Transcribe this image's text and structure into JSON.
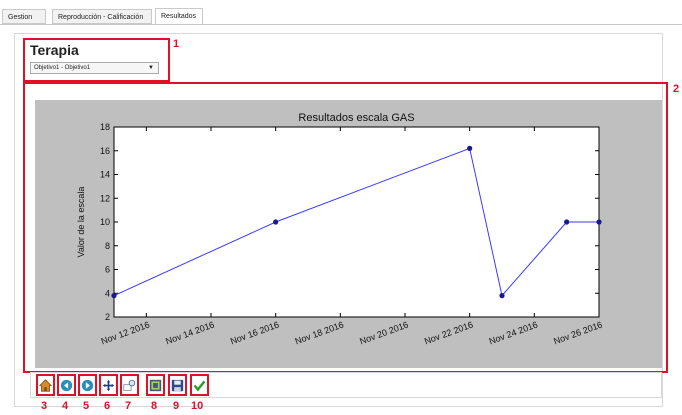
{
  "tabs": [
    {
      "label": "Gestion"
    },
    {
      "label": "Reproducción - Calificación"
    },
    {
      "label": "Resultados"
    }
  ],
  "section": {
    "title": "Terapia",
    "selected_objective": "Objetivo1 - Objetivo1"
  },
  "annotations": [
    "1",
    "2",
    "3",
    "4",
    "5",
    "6",
    "7",
    "8",
    "9",
    "10"
  ],
  "toolbar": [
    {
      "icon": "home-icon"
    },
    {
      "icon": "back-arrow-icon"
    },
    {
      "icon": "forward-arrow-icon"
    },
    {
      "icon": "pan-move-icon"
    },
    {
      "icon": "zoom-rect-icon"
    },
    {
      "icon": "configure-subplots-icon"
    },
    {
      "icon": "save-icon"
    },
    {
      "icon": "check-icon"
    }
  ],
  "colors": {
    "annotation": "#e0102a",
    "line": "#3a3aff",
    "marker": "#1a1a8c",
    "figure_bg": "#bfbfbf"
  },
  "chart_data": {
    "type": "line",
    "title": "Resultados escala GAS",
    "xlabel": "",
    "ylabel": "Valor de la escala",
    "x_ticks": [
      "Nov 12 2016",
      "Nov 14 2016",
      "Nov 16 2016",
      "Nov 18 2016",
      "Nov 20 2016",
      "Nov 22 2016",
      "Nov 24 2016",
      "Nov 26 2016"
    ],
    "series": [
      {
        "x": [
          "2016-11-11",
          "2016-11-16",
          "2016-11-22",
          "2016-11-23",
          "2016-11-25",
          "2016-11-26"
        ],
        "y": [
          3.8,
          10.0,
          16.2,
          3.8,
          10.0,
          10.0
        ]
      }
    ],
    "xlim": [
      "2016-11-11",
      "2016-11-26"
    ],
    "ylim": [
      2,
      18
    ],
    "y_ticks": [
      2,
      4,
      6,
      8,
      10,
      12,
      14,
      16,
      18
    ],
    "grid": false
  }
}
